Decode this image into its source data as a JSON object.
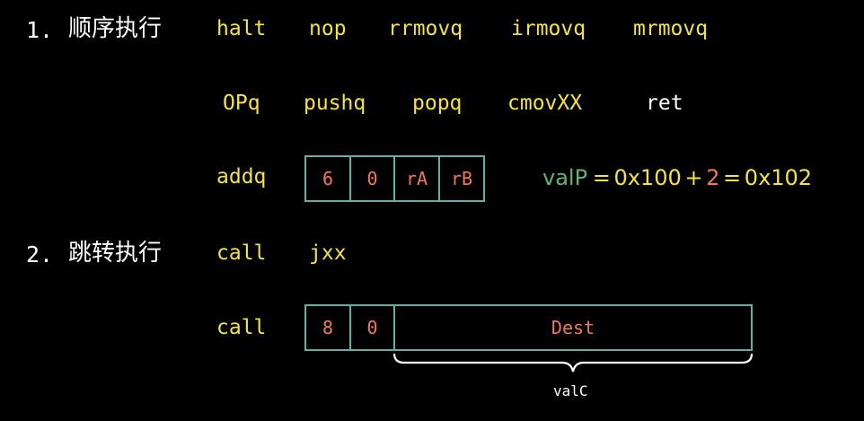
{
  "section1": {
    "number": "1.",
    "label": "顺序执行"
  },
  "section2": {
    "number": "2.",
    "label": "跳转执行"
  },
  "row1": [
    "halt",
    "nop",
    "rrmovq",
    "irmovq",
    "mrmovq"
  ],
  "row2": [
    "OPq",
    "pushq",
    "popq",
    "cmovXX",
    "ret"
  ],
  "addq": {
    "name": "addq",
    "fields": [
      "6",
      "0",
      "rA",
      "rB"
    ]
  },
  "valp": {
    "var": "valP",
    "eq1": "=",
    "base": "0x100",
    "plus": "+",
    "len": "2",
    "eq2": "=",
    "result": "0x102"
  },
  "row3": [
    "call",
    "jxx"
  ],
  "call": {
    "name": "call",
    "fields": [
      "8",
      "0",
      "Dest"
    ],
    "brace_label": "valC"
  },
  "colors": {
    "yellow": "#f3e24a",
    "teal_border": "#5ab3a6",
    "orange": "#ee7a5a",
    "green": "#6bae74",
    "white": "#ffffff"
  }
}
